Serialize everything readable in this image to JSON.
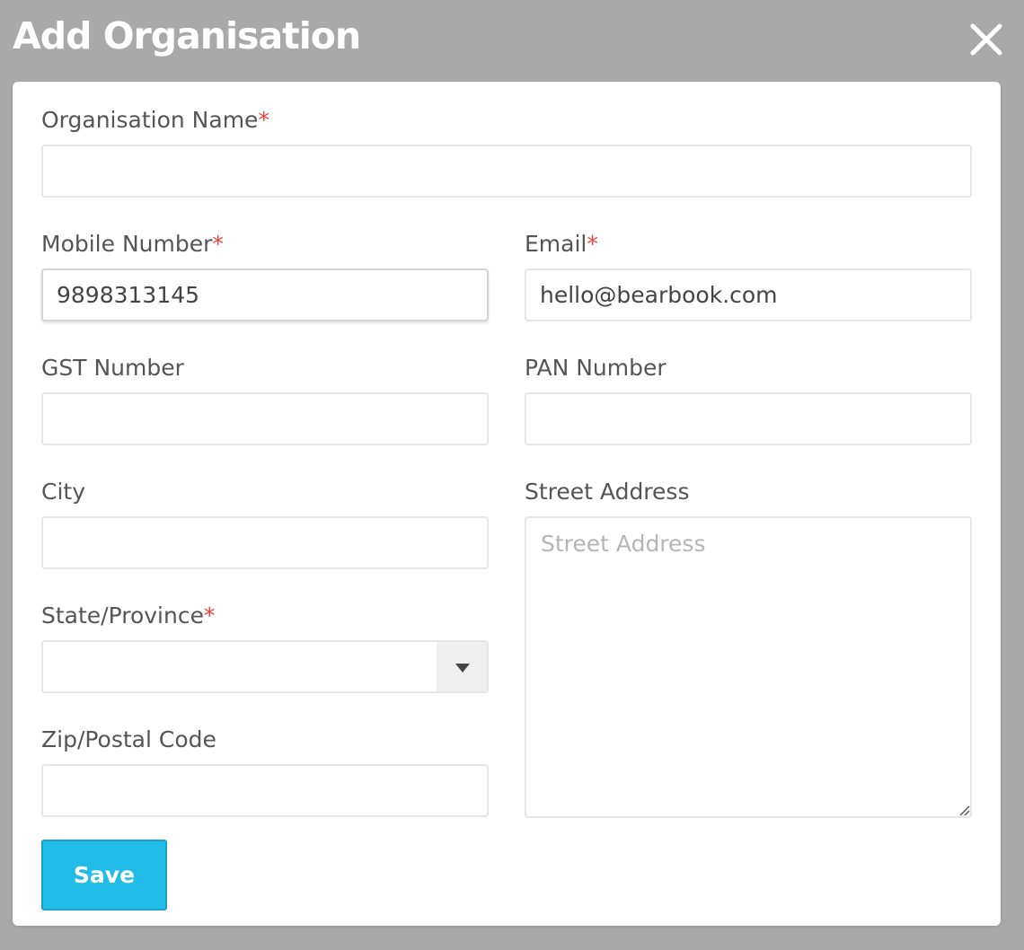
{
  "modal": {
    "title": "Add Organisation"
  },
  "form": {
    "org_name": {
      "label": "Organisation Name",
      "required_mark": "*",
      "value": ""
    },
    "mobile": {
      "label": "Mobile Number",
      "required_mark": "*",
      "value": "9898313145"
    },
    "email": {
      "label": "Email",
      "required_mark": "*",
      "value": "hello@bearbook.com"
    },
    "gst": {
      "label": "GST Number",
      "value": ""
    },
    "pan": {
      "label": "PAN Number",
      "value": ""
    },
    "city": {
      "label": "City",
      "value": ""
    },
    "street": {
      "label": "Street Address",
      "placeholder": "Street Address",
      "value": ""
    },
    "state": {
      "label": "State/Province",
      "required_mark": "*",
      "value": ""
    },
    "zip": {
      "label": "Zip/Postal Code",
      "value": ""
    },
    "save_label": "Save"
  },
  "colors": {
    "backdrop": "#a9a9a9",
    "accent": "#21bce8",
    "required": "#e8423f"
  },
  "icons": {
    "close": "close-icon",
    "dropdown": "caret-down-icon",
    "resize": "resize-grip-icon"
  }
}
